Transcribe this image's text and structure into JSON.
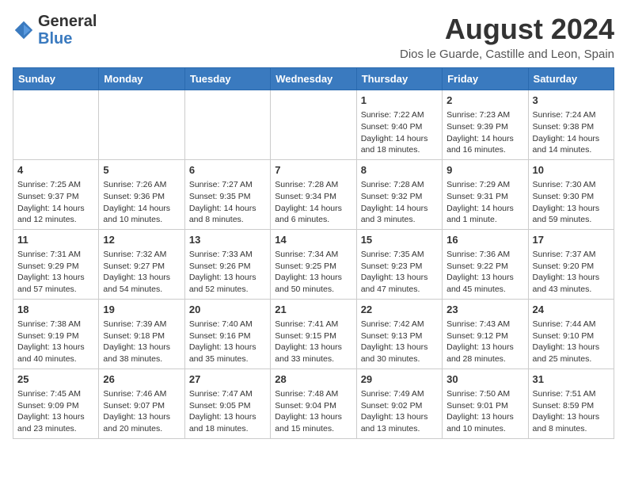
{
  "header": {
    "logo": {
      "general": "General",
      "blue": "Blue"
    },
    "title": "August 2024",
    "location": "Dios le Guarde, Castille and Leon, Spain"
  },
  "weekdays": [
    "Sunday",
    "Monday",
    "Tuesday",
    "Wednesday",
    "Thursday",
    "Friday",
    "Saturday"
  ],
  "weeks": [
    [
      {
        "day": "",
        "info": ""
      },
      {
        "day": "",
        "info": ""
      },
      {
        "day": "",
        "info": ""
      },
      {
        "day": "",
        "info": ""
      },
      {
        "day": "1",
        "info": "Sunrise: 7:22 AM\nSunset: 9:40 PM\nDaylight: 14 hours and 18 minutes."
      },
      {
        "day": "2",
        "info": "Sunrise: 7:23 AM\nSunset: 9:39 PM\nDaylight: 14 hours and 16 minutes."
      },
      {
        "day": "3",
        "info": "Sunrise: 7:24 AM\nSunset: 9:38 PM\nDaylight: 14 hours and 14 minutes."
      }
    ],
    [
      {
        "day": "4",
        "info": "Sunrise: 7:25 AM\nSunset: 9:37 PM\nDaylight: 14 hours and 12 minutes."
      },
      {
        "day": "5",
        "info": "Sunrise: 7:26 AM\nSunset: 9:36 PM\nDaylight: 14 hours and 10 minutes."
      },
      {
        "day": "6",
        "info": "Sunrise: 7:27 AM\nSunset: 9:35 PM\nDaylight: 14 hours and 8 minutes."
      },
      {
        "day": "7",
        "info": "Sunrise: 7:28 AM\nSunset: 9:34 PM\nDaylight: 14 hours and 6 minutes."
      },
      {
        "day": "8",
        "info": "Sunrise: 7:28 AM\nSunset: 9:32 PM\nDaylight: 14 hours and 3 minutes."
      },
      {
        "day": "9",
        "info": "Sunrise: 7:29 AM\nSunset: 9:31 PM\nDaylight: 14 hours and 1 minute."
      },
      {
        "day": "10",
        "info": "Sunrise: 7:30 AM\nSunset: 9:30 PM\nDaylight: 13 hours and 59 minutes."
      }
    ],
    [
      {
        "day": "11",
        "info": "Sunrise: 7:31 AM\nSunset: 9:29 PM\nDaylight: 13 hours and 57 minutes."
      },
      {
        "day": "12",
        "info": "Sunrise: 7:32 AM\nSunset: 9:27 PM\nDaylight: 13 hours and 54 minutes."
      },
      {
        "day": "13",
        "info": "Sunrise: 7:33 AM\nSunset: 9:26 PM\nDaylight: 13 hours and 52 minutes."
      },
      {
        "day": "14",
        "info": "Sunrise: 7:34 AM\nSunset: 9:25 PM\nDaylight: 13 hours and 50 minutes."
      },
      {
        "day": "15",
        "info": "Sunrise: 7:35 AM\nSunset: 9:23 PM\nDaylight: 13 hours and 47 minutes."
      },
      {
        "day": "16",
        "info": "Sunrise: 7:36 AM\nSunset: 9:22 PM\nDaylight: 13 hours and 45 minutes."
      },
      {
        "day": "17",
        "info": "Sunrise: 7:37 AM\nSunset: 9:20 PM\nDaylight: 13 hours and 43 minutes."
      }
    ],
    [
      {
        "day": "18",
        "info": "Sunrise: 7:38 AM\nSunset: 9:19 PM\nDaylight: 13 hours and 40 minutes."
      },
      {
        "day": "19",
        "info": "Sunrise: 7:39 AM\nSunset: 9:18 PM\nDaylight: 13 hours and 38 minutes."
      },
      {
        "day": "20",
        "info": "Sunrise: 7:40 AM\nSunset: 9:16 PM\nDaylight: 13 hours and 35 minutes."
      },
      {
        "day": "21",
        "info": "Sunrise: 7:41 AM\nSunset: 9:15 PM\nDaylight: 13 hours and 33 minutes."
      },
      {
        "day": "22",
        "info": "Sunrise: 7:42 AM\nSunset: 9:13 PM\nDaylight: 13 hours and 30 minutes."
      },
      {
        "day": "23",
        "info": "Sunrise: 7:43 AM\nSunset: 9:12 PM\nDaylight: 13 hours and 28 minutes."
      },
      {
        "day": "24",
        "info": "Sunrise: 7:44 AM\nSunset: 9:10 PM\nDaylight: 13 hours and 25 minutes."
      }
    ],
    [
      {
        "day": "25",
        "info": "Sunrise: 7:45 AM\nSunset: 9:09 PM\nDaylight: 13 hours and 23 minutes."
      },
      {
        "day": "26",
        "info": "Sunrise: 7:46 AM\nSunset: 9:07 PM\nDaylight: 13 hours and 20 minutes."
      },
      {
        "day": "27",
        "info": "Sunrise: 7:47 AM\nSunset: 9:05 PM\nDaylight: 13 hours and 18 minutes."
      },
      {
        "day": "28",
        "info": "Sunrise: 7:48 AM\nSunset: 9:04 PM\nDaylight: 13 hours and 15 minutes."
      },
      {
        "day": "29",
        "info": "Sunrise: 7:49 AM\nSunset: 9:02 PM\nDaylight: 13 hours and 13 minutes."
      },
      {
        "day": "30",
        "info": "Sunrise: 7:50 AM\nSunset: 9:01 PM\nDaylight: 13 hours and 10 minutes."
      },
      {
        "day": "31",
        "info": "Sunrise: 7:51 AM\nSunset: 8:59 PM\nDaylight: 13 hours and 8 minutes."
      }
    ]
  ]
}
